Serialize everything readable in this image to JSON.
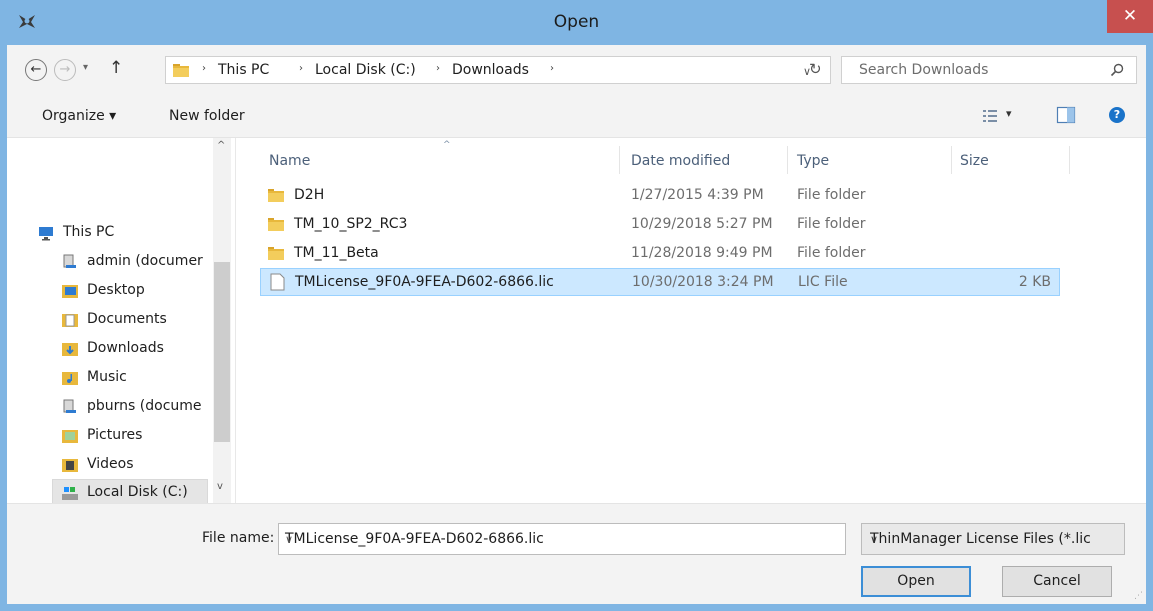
{
  "window": {
    "title": "Open",
    "close_glyph": "✕",
    "accent_color": "#7fb5e3"
  },
  "address_bar": {
    "back_glyph": "←",
    "forward_glyph": "→",
    "up_glyph": "↑",
    "recent_glyph": "▾",
    "crumbs": [
      "This PC",
      "Local Disk (C:)",
      "Downloads"
    ],
    "separator": "›",
    "dropdown_glyph": "∨",
    "refresh_glyph": "↻",
    "search_placeholder": "Search Downloads",
    "icons": {
      "folder": "folder-icon",
      "search": "search-icon"
    }
  },
  "toolbar": {
    "organize": "Organize ▾",
    "new_folder": "New folder",
    "view_glyph": "▾",
    "help_glyph": "?",
    "icons": {
      "view": "view-options-icon",
      "preview": "preview-pane-icon",
      "help": "help-icon"
    }
  },
  "nav": {
    "scroll_up": "^",
    "scroll_down": "v",
    "items": [
      {
        "label": "This PC",
        "icon": "computer-icon"
      },
      {
        "label": "admin (documer",
        "icon": "network-share-icon"
      },
      {
        "label": "Desktop",
        "icon": "desktop-folder-icon"
      },
      {
        "label": "Documents",
        "icon": "documents-folder-icon"
      },
      {
        "label": "Downloads",
        "icon": "downloads-folder-icon"
      },
      {
        "label": "Music",
        "icon": "music-folder-icon"
      },
      {
        "label": "pburns (docume",
        "icon": "network-share-icon"
      },
      {
        "label": "Pictures",
        "icon": "pictures-folder-icon"
      },
      {
        "label": "Videos",
        "icon": "videos-folder-icon"
      },
      {
        "label": "Local Disk (C:)",
        "icon": "local-disk-icon",
        "selected": true
      }
    ]
  },
  "file_list": {
    "columns": {
      "name": "Name",
      "date": "Date modified",
      "type": "Type",
      "size": "Size"
    },
    "sort_glyph": "^",
    "rows": [
      {
        "name": "D2H",
        "date": "1/27/2015 4:39 PM",
        "type": "File folder",
        "size": "",
        "icon": "folder-icon"
      },
      {
        "name": "TM_10_SP2_RC3",
        "date": "10/29/2018 5:27 PM",
        "type": "File folder",
        "size": "",
        "icon": "folder-icon"
      },
      {
        "name": "TM_11_Beta",
        "date": "11/28/2018 9:49 PM",
        "type": "File folder",
        "size": "",
        "icon": "folder-icon"
      },
      {
        "name": "TMLicense_9F0A-9FEA-D602-6866.lic",
        "date": "10/30/2018 3:24 PM",
        "type": "LIC File",
        "size": "2 KB",
        "icon": "file-icon",
        "selected": true
      }
    ],
    "selection_color": "#cce8ff"
  },
  "footer": {
    "file_name_label": "File name:",
    "file_name_value": "TMLicense_9F0A-9FEA-D602-6866.lic",
    "dropdown_glyph": "∨",
    "filter_value": "ThinManager License Files (*.lic",
    "open_label": "Open",
    "cancel_label": "Cancel",
    "grip_glyph": "⋰"
  }
}
